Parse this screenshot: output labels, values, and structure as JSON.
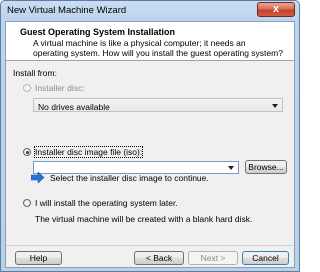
{
  "window": {
    "title": "New Virtual Machine Wizard",
    "close_glyph": "x"
  },
  "header": {
    "title": "Guest Operating System Installation",
    "description": "A virtual machine is like a physical computer; it needs an operating system. How will you install the guest operating system?"
  },
  "install_from": {
    "label": "Install from:",
    "options": [
      {
        "label": "Installer disc:",
        "selected": false,
        "enabled": false,
        "combo_value": "No drives available"
      },
      {
        "label": "Installer disc image file (iso):",
        "selected": true,
        "enabled": true,
        "combo_value": "",
        "browse_label": "Browse...",
        "hint": "Select the installer disc image to continue."
      },
      {
        "label": "I will install the operating system later.",
        "selected": false,
        "enabled": true,
        "note": "The virtual machine will be created with a blank hard disk."
      }
    ]
  },
  "buttons": {
    "help": "Help",
    "back": "< Back",
    "next": "Next >",
    "cancel": "Cancel"
  },
  "icons": {
    "info": "arrow-info-icon",
    "close": "close-icon"
  },
  "colors": {
    "accent": "#3c7fb1",
    "info_arrow": "#2b74d6"
  }
}
